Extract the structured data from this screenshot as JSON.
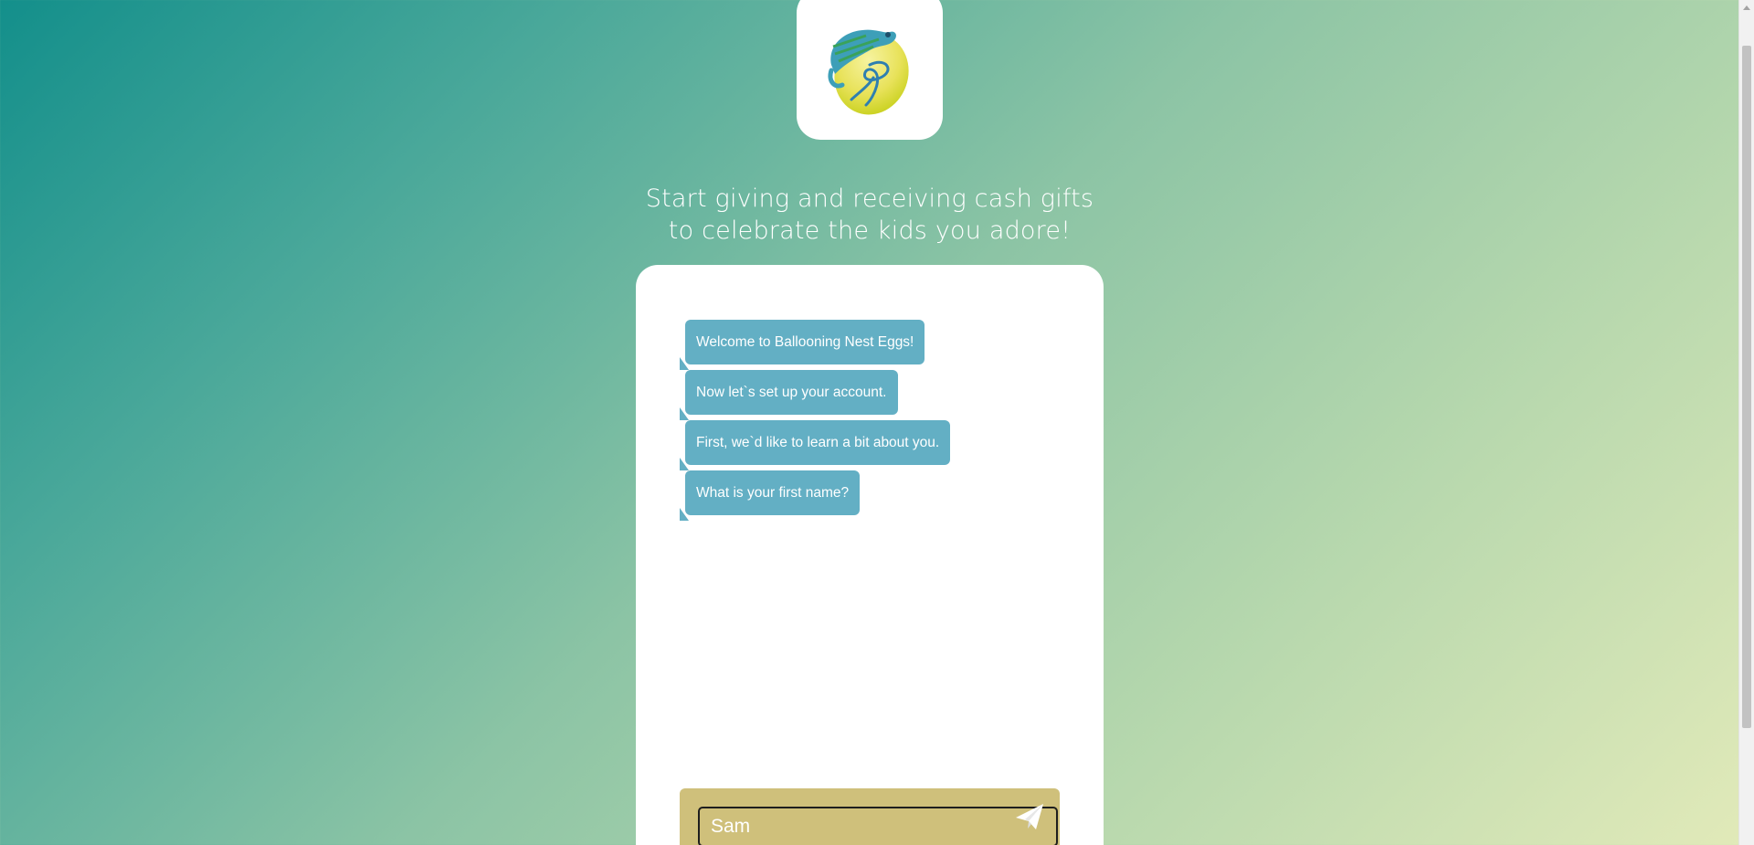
{
  "header": {
    "logo_name": "ballooning-nest-eggs-logo"
  },
  "tagline": {
    "line1": "Start giving and receiving cash gifts",
    "line2": "to celebrate the kids you adore!"
  },
  "chat": {
    "messages": [
      "Welcome to Ballooning Nest Eggs!",
      "Now let`s set up your account.",
      "First, we`d like to learn a bit about you.",
      "What is your first name?"
    ],
    "input_value": "Sam",
    "send_icon": "paper-plane-icon"
  },
  "colors": {
    "bubble": "#63afc4",
    "input_panel": "#cfc07b",
    "gradient_start": "#138f8b",
    "gradient_end": "#e2eab9"
  }
}
